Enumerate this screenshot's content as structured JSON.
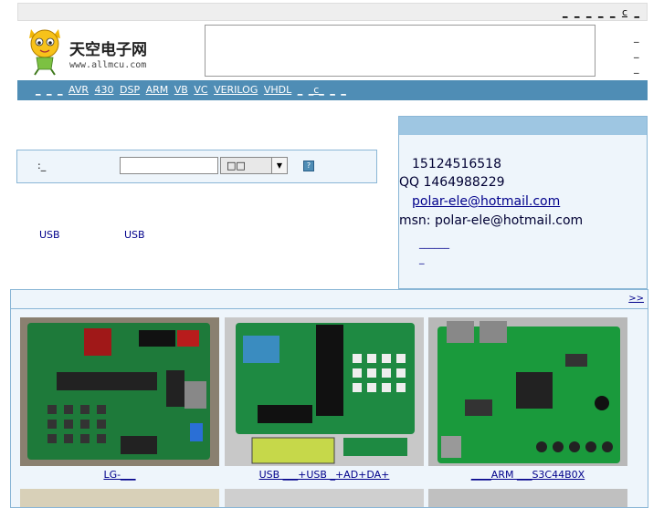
{
  "topbar": {
    "links": [
      "_",
      "_",
      "_",
      "_",
      "_",
      "c",
      "_"
    ]
  },
  "header": {
    "logo_title": "天空电子网",
    "logo_url": "www.allmcu.com",
    "right_links": [
      "_",
      "_",
      "_"
    ]
  },
  "nav": {
    "items": [
      "_",
      "_",
      "_",
      "AVR",
      "430",
      "DSP",
      "ARM",
      "VB",
      "VC",
      "VERILOG",
      "VHDL",
      "_",
      "_c_",
      "_",
      "_"
    ]
  },
  "search": {
    "label": ":_",
    "input_value": "",
    "select_value": "□□",
    "go_label": "?"
  },
  "usb_links": {
    "left": "USB",
    "right": "USB"
  },
  "contact": {
    "phone": "15124516518",
    "qq": "QQ 1464988229",
    "email": "polar-ele@hotmail.com",
    "msn": "msn: polar-ele@hotmail.com",
    "links": [
      "______",
      "_"
    ]
  },
  "products": {
    "more_label": ">>",
    "items": [
      {
        "caption": "LG-___"
      },
      {
        "caption": "USB ___+USB _+AD+DA+"
      },
      {
        "caption": "____ARM ___S3C44B0X"
      }
    ]
  }
}
